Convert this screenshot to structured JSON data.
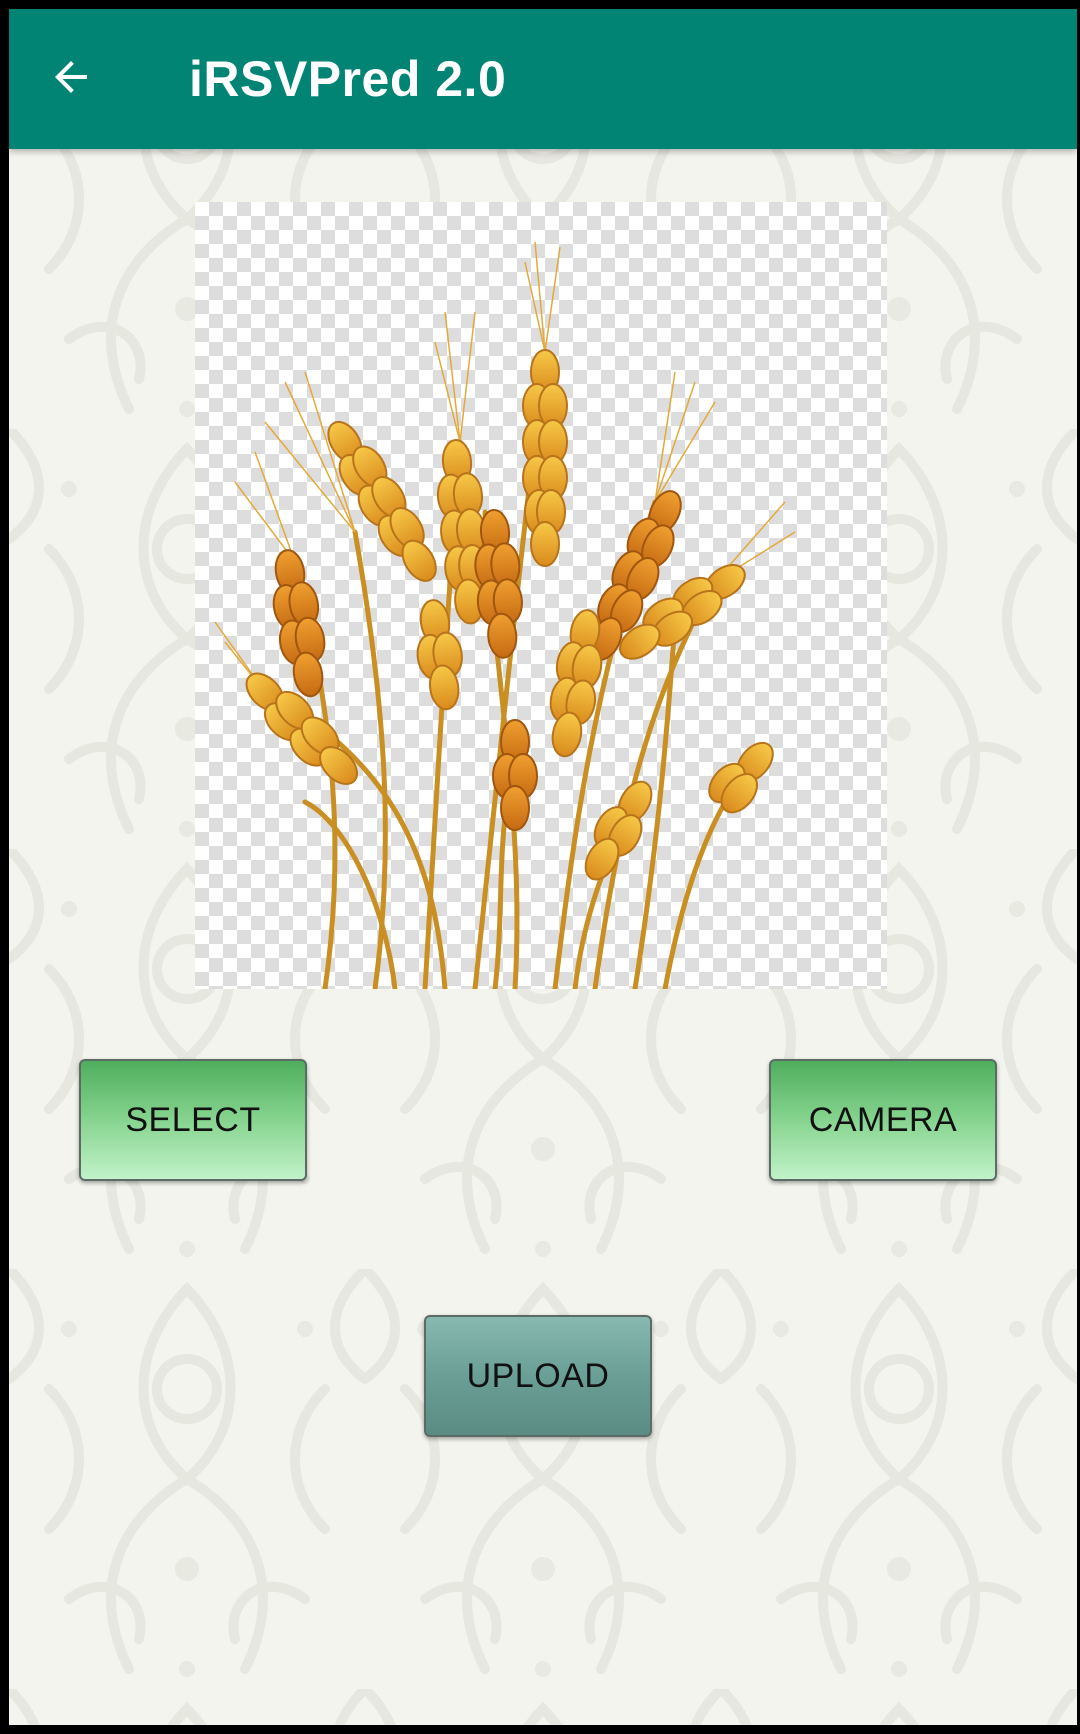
{
  "app_bar": {
    "title": "iRSVPred 2.0",
    "back_icon": "arrow-back-icon",
    "color": "#028475"
  },
  "image_view": {
    "content": "wheat-ears-image"
  },
  "buttons": {
    "select_label": "SELECT",
    "camera_label": "CAMERA",
    "upload_label": "UPLOAD"
  },
  "colors": {
    "background": "#f4f4ee",
    "button_green_top": "#4fae5e",
    "button_green_bottom": "#c1f2c9",
    "button_teal": "#6a9f96"
  }
}
